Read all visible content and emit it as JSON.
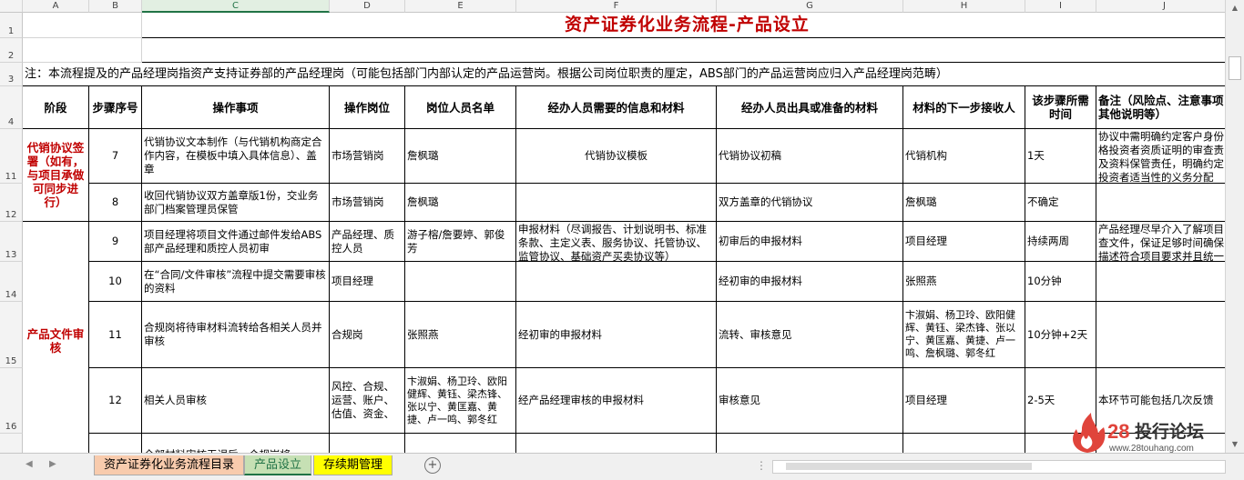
{
  "columns": [
    "A",
    "B",
    "C",
    "D",
    "E",
    "F",
    "G",
    "H",
    "I",
    "J"
  ],
  "rows": [
    "1",
    "2",
    "3",
    "4",
    "11",
    "12",
    "13",
    "14",
    "15",
    "16"
  ],
  "title": "资产证券化业务流程-产品设立",
  "note": "注：本流程提及的产品经理岗指资产支持证券部的产品经理岗（可能包括部门内部认定的产品运营岗。根据公司岗位职责的厘定，ABS部门的产品运营岗应归入产品经理岗范畴）",
  "headers": {
    "stage": "阶段",
    "step": "步骤序号",
    "action": "操作事项",
    "position": "操作岗位",
    "staff": "岗位人员名单",
    "info_needed": "经办人员需要的信息和材料",
    "output": "经办人员出具或准备的材料",
    "next_receiver": "材料的下一步接收人",
    "time_needed": "该步骤所需时间",
    "remarks": "备注（风险点、注意事项其他说明等）"
  },
  "stage1": "代销协议签署（如有，与项目承做可同步进行）",
  "stage2": "产品文件审核",
  "data_rows": [
    {
      "step": "7",
      "action": "代销协议文本制作（与代销机构商定合作内容，在模板中填入具体信息）、盖章",
      "position": "市场营销岗",
      "staff": "詹枫璐",
      "info": "代销协议模板",
      "output": "代销协议初稿",
      "next": "代销机构",
      "time": "1天",
      "remark": "协议中需明确约定客户身份格投资者资质证明的审查责及资料保管责任，明确约定投资者适当性的义务分配"
    },
    {
      "step": "8",
      "action": "收回代销协议双方盖章版1份，交业务部门档案管理员保管",
      "position": "市场营销岗",
      "staff": "詹枫璐",
      "info": "",
      "output": "双方盖章的代销协议",
      "next": "詹枫璐",
      "time": "不确定",
      "remark": ""
    },
    {
      "step": "9",
      "action": "项目经理将项目文件通过邮件发给ABS部产品经理和质控人员初审",
      "position": "产品经理、质控人员",
      "staff": "游子榕/詹要婷、郭俊芳",
      "info": "申报材料（尽调报告、计划说明书、标准条款、主定义表、服务协议、托管协议、监管协议、基础资产买卖协议等）",
      "output": "初审后的申报材料",
      "next": "项目经理",
      "time": "持续两周",
      "remark": "产品经理尽早介入了解项目查文件，保证足够时间确保描述符合项目要求并且统一"
    },
    {
      "step": "10",
      "action": "在“合同/文件审核”流程中提交需要审核的资料",
      "position": "项目经理",
      "staff": "",
      "info": "",
      "output": "经初审的申报材料",
      "next": "张照燕",
      "time": "10分钟",
      "remark": ""
    },
    {
      "step": "11",
      "action": "合规岗将待审材料流转给各相关人员并审核",
      "position": "合规岗",
      "staff": "张照燕",
      "info": "经初审的申报材料",
      "output": "流转、审核意见",
      "next": "卞淑娟、杨卫玲、欧阳健辉、黄钰、梁杰锋、张以宁、黄匡嘉、黄捷、卢一鸣、詹枫璐、郭冬红",
      "time": "10分钟+2天",
      "remark": ""
    },
    {
      "step": "12",
      "action": "相关人员审核",
      "position": "风控、合规、运营、账户、估值、资金、",
      "staff": "卞淑娟、杨卫玲、欧阳健辉、黄钰、梁杰锋、张以宁、黄匡嘉、黄捷、卢一鸣、郭冬红",
      "info": "经产品经理审核的申报材料",
      "output": "审核意见",
      "next": "项目经理",
      "time": "2-5天",
      "remark": "本环节可能包括几次反馈"
    }
  ],
  "partial_row_text": "全部材料审核无误后，合规岗将",
  "tabs": [
    {
      "label": "资产证券化业务流程目录",
      "color": "#f8cbad"
    },
    {
      "label": "产品设立",
      "color": "#c6e0b4"
    },
    {
      "label": "存续期管理",
      "color": "#ffff00"
    }
  ],
  "logo": {
    "brand": "投行论坛",
    "number": "28",
    "url": "www.28touhang.com"
  }
}
